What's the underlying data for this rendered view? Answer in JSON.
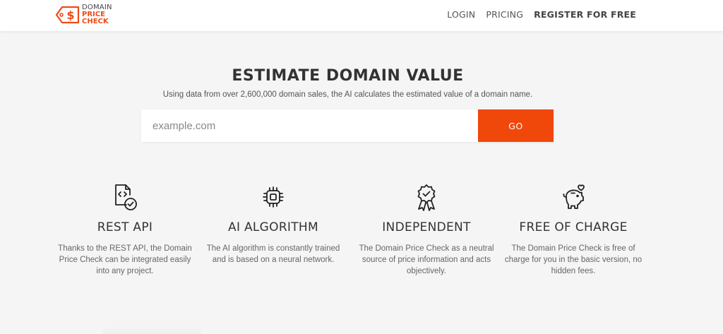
{
  "header": {
    "logo": {
      "line1": "DOMAIN",
      "line2": "PRICE",
      "line3": "CHECK",
      "symbol": "$"
    },
    "nav": [
      {
        "label": "LOGIN"
      },
      {
        "label": "PRICING"
      },
      {
        "label": "REGISTER FOR FREE"
      }
    ]
  },
  "hero": {
    "title": "ESTIMATE DOMAIN VALUE",
    "subtitle": "Using data from over 2,600,000 domain sales, the AI calculates the estimated value of a domain name.",
    "search_placeholder": "example.com",
    "go_label": "GO"
  },
  "features": [
    {
      "icon": "api-document-icon",
      "title": "REST API",
      "text": "Thanks to the REST API, the Domain Price Check can be integrated easily into any project."
    },
    {
      "icon": "chip-icon",
      "title": "AI ALGORITHM",
      "text": "The AI algorithm is constantly trained and is based on a neural network."
    },
    {
      "icon": "award-badge-icon",
      "title": "INDEPENDENT",
      "text": "The Domain Price Check as a neutral source of price information and acts objectively."
    },
    {
      "icon": "piggy-bank-heart-icon",
      "title": "FREE OF CHARGE",
      "text": "The Domain Price Check is free of charge for you in the basic version, no hidden fees."
    }
  ],
  "colors": {
    "accent": "#f0480a",
    "background": "#f5f5f5",
    "text": "#333333"
  }
}
